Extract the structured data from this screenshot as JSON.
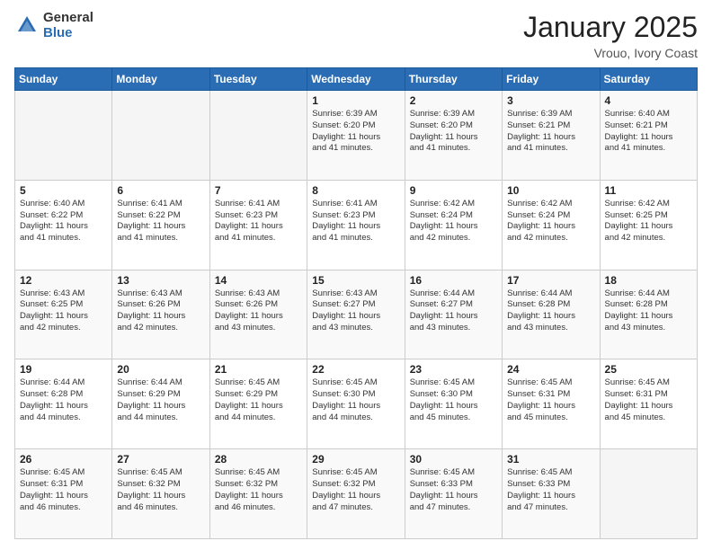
{
  "header": {
    "logo_general": "General",
    "logo_blue": "Blue",
    "title": "January 2025",
    "subtitle": "Vrouo, Ivory Coast"
  },
  "weekdays": [
    "Sunday",
    "Monday",
    "Tuesday",
    "Wednesday",
    "Thursday",
    "Friday",
    "Saturday"
  ],
  "weeks": [
    [
      {
        "day": "",
        "info": ""
      },
      {
        "day": "",
        "info": ""
      },
      {
        "day": "",
        "info": ""
      },
      {
        "day": "1",
        "info": "Sunrise: 6:39 AM\nSunset: 6:20 PM\nDaylight: 11 hours\nand 41 minutes."
      },
      {
        "day": "2",
        "info": "Sunrise: 6:39 AM\nSunset: 6:20 PM\nDaylight: 11 hours\nand 41 minutes."
      },
      {
        "day": "3",
        "info": "Sunrise: 6:39 AM\nSunset: 6:21 PM\nDaylight: 11 hours\nand 41 minutes."
      },
      {
        "day": "4",
        "info": "Sunrise: 6:40 AM\nSunset: 6:21 PM\nDaylight: 11 hours\nand 41 minutes."
      }
    ],
    [
      {
        "day": "5",
        "info": "Sunrise: 6:40 AM\nSunset: 6:22 PM\nDaylight: 11 hours\nand 41 minutes."
      },
      {
        "day": "6",
        "info": "Sunrise: 6:41 AM\nSunset: 6:22 PM\nDaylight: 11 hours\nand 41 minutes."
      },
      {
        "day": "7",
        "info": "Sunrise: 6:41 AM\nSunset: 6:23 PM\nDaylight: 11 hours\nand 41 minutes."
      },
      {
        "day": "8",
        "info": "Sunrise: 6:41 AM\nSunset: 6:23 PM\nDaylight: 11 hours\nand 41 minutes."
      },
      {
        "day": "9",
        "info": "Sunrise: 6:42 AM\nSunset: 6:24 PM\nDaylight: 11 hours\nand 42 minutes."
      },
      {
        "day": "10",
        "info": "Sunrise: 6:42 AM\nSunset: 6:24 PM\nDaylight: 11 hours\nand 42 minutes."
      },
      {
        "day": "11",
        "info": "Sunrise: 6:42 AM\nSunset: 6:25 PM\nDaylight: 11 hours\nand 42 minutes."
      }
    ],
    [
      {
        "day": "12",
        "info": "Sunrise: 6:43 AM\nSunset: 6:25 PM\nDaylight: 11 hours\nand 42 minutes."
      },
      {
        "day": "13",
        "info": "Sunrise: 6:43 AM\nSunset: 6:26 PM\nDaylight: 11 hours\nand 42 minutes."
      },
      {
        "day": "14",
        "info": "Sunrise: 6:43 AM\nSunset: 6:26 PM\nDaylight: 11 hours\nand 43 minutes."
      },
      {
        "day": "15",
        "info": "Sunrise: 6:43 AM\nSunset: 6:27 PM\nDaylight: 11 hours\nand 43 minutes."
      },
      {
        "day": "16",
        "info": "Sunrise: 6:44 AM\nSunset: 6:27 PM\nDaylight: 11 hours\nand 43 minutes."
      },
      {
        "day": "17",
        "info": "Sunrise: 6:44 AM\nSunset: 6:28 PM\nDaylight: 11 hours\nand 43 minutes."
      },
      {
        "day": "18",
        "info": "Sunrise: 6:44 AM\nSunset: 6:28 PM\nDaylight: 11 hours\nand 43 minutes."
      }
    ],
    [
      {
        "day": "19",
        "info": "Sunrise: 6:44 AM\nSunset: 6:28 PM\nDaylight: 11 hours\nand 44 minutes."
      },
      {
        "day": "20",
        "info": "Sunrise: 6:44 AM\nSunset: 6:29 PM\nDaylight: 11 hours\nand 44 minutes."
      },
      {
        "day": "21",
        "info": "Sunrise: 6:45 AM\nSunset: 6:29 PM\nDaylight: 11 hours\nand 44 minutes."
      },
      {
        "day": "22",
        "info": "Sunrise: 6:45 AM\nSunset: 6:30 PM\nDaylight: 11 hours\nand 44 minutes."
      },
      {
        "day": "23",
        "info": "Sunrise: 6:45 AM\nSunset: 6:30 PM\nDaylight: 11 hours\nand 45 minutes."
      },
      {
        "day": "24",
        "info": "Sunrise: 6:45 AM\nSunset: 6:31 PM\nDaylight: 11 hours\nand 45 minutes."
      },
      {
        "day": "25",
        "info": "Sunrise: 6:45 AM\nSunset: 6:31 PM\nDaylight: 11 hours\nand 45 minutes."
      }
    ],
    [
      {
        "day": "26",
        "info": "Sunrise: 6:45 AM\nSunset: 6:31 PM\nDaylight: 11 hours\nand 46 minutes."
      },
      {
        "day": "27",
        "info": "Sunrise: 6:45 AM\nSunset: 6:32 PM\nDaylight: 11 hours\nand 46 minutes."
      },
      {
        "day": "28",
        "info": "Sunrise: 6:45 AM\nSunset: 6:32 PM\nDaylight: 11 hours\nand 46 minutes."
      },
      {
        "day": "29",
        "info": "Sunrise: 6:45 AM\nSunset: 6:32 PM\nDaylight: 11 hours\nand 47 minutes."
      },
      {
        "day": "30",
        "info": "Sunrise: 6:45 AM\nSunset: 6:33 PM\nDaylight: 11 hours\nand 47 minutes."
      },
      {
        "day": "31",
        "info": "Sunrise: 6:45 AM\nSunset: 6:33 PM\nDaylight: 11 hours\nand 47 minutes."
      },
      {
        "day": "",
        "info": ""
      }
    ]
  ]
}
